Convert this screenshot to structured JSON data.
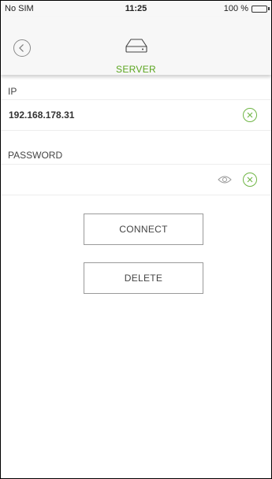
{
  "status_bar": {
    "carrier": "No SIM",
    "time": "11:25",
    "battery": "100 %",
    "battery_color": "#4cd964"
  },
  "header": {
    "title": "SERVER",
    "title_color": "#5aa51e",
    "back_icon": "chevron-left-circle-icon",
    "server_icon": "server-drive-icon"
  },
  "form": {
    "ip_label": "IP",
    "ip_value": "192.168.178.31",
    "password_label": "PASSWORD",
    "password_value": "",
    "clear_icon": "clear-circle-x-icon",
    "eye_icon": "eye-icon"
  },
  "actions": {
    "connect_label": "CONNECT",
    "delete_label": "DELETE"
  }
}
